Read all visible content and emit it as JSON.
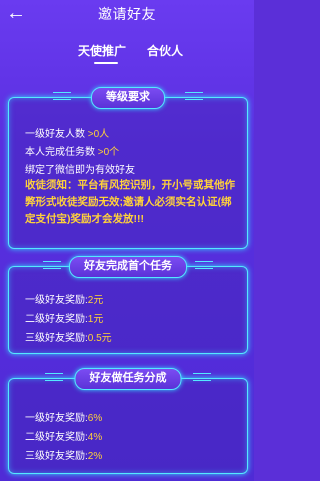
{
  "header": {
    "title": "邀请好友"
  },
  "tabs": [
    {
      "label": "天使推广"
    },
    {
      "label": "合伙人"
    }
  ],
  "requirements": {
    "title": "等级要求",
    "rows": [
      {
        "label": "一级好友人数 ",
        "value": ">0人"
      },
      {
        "label": "本人完成任务数 ",
        "value": ">0个"
      }
    ],
    "bind_note": "绑定了微信即为有效好友",
    "warning": "收徒须知：平台有风控识别，开小号或其他作弊形式收徒奖励无效;邀请人必须实名认证(绑定支付宝)奖励才会发放!!!"
  },
  "first_task": {
    "title": "好友完成首个任务",
    "rows": [
      {
        "label": "一级好友奖励:",
        "value": "2元"
      },
      {
        "label": "二级好友奖励:",
        "value": "1元"
      },
      {
        "label": "三级好友奖励:",
        "value": "0.5元"
      }
    ]
  },
  "share": {
    "title": "好友做任务分成",
    "rows": [
      {
        "label": "一级好友奖励:",
        "value": "6%"
      },
      {
        "label": "二级好友奖励:",
        "value": "4%"
      },
      {
        "label": "三级好友奖励:",
        "value": "2%"
      }
    ]
  },
  "colors": {
    "accent": "#55e8ff",
    "highlight": "#ffd23a",
    "background": "#5b2fd8"
  }
}
